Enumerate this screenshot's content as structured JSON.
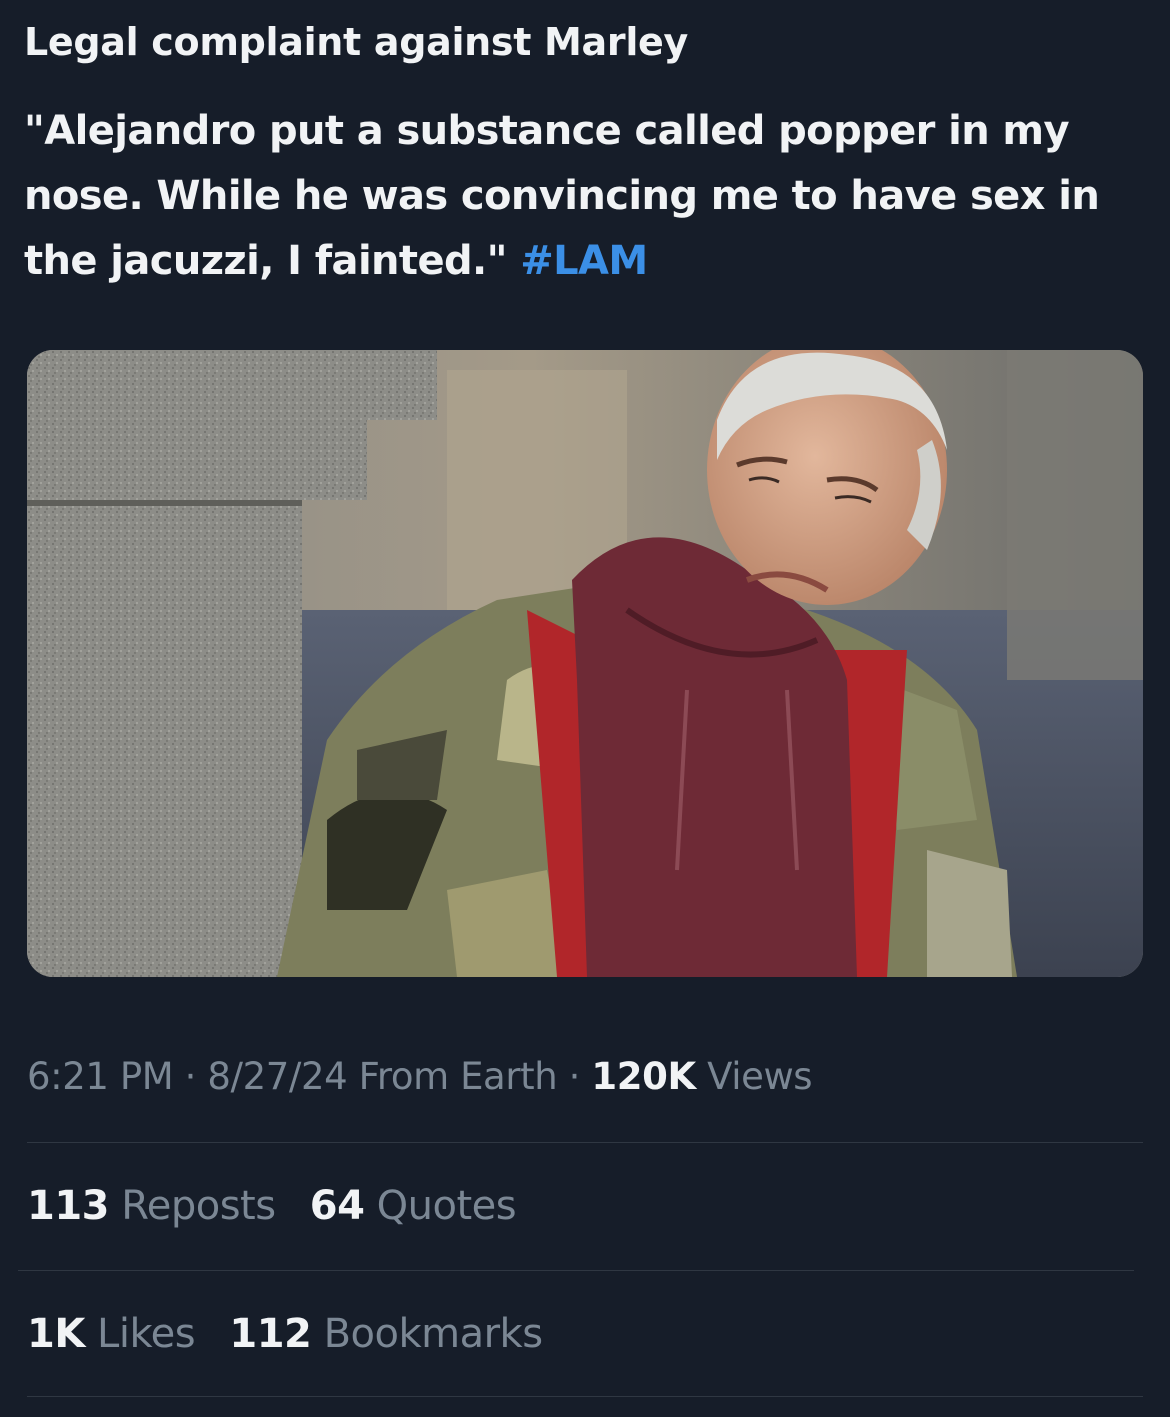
{
  "post": {
    "title": "Legal complaint against Marley",
    "text_line1": "\"Alejandro put a substance called popper in my",
    "text_line2": "nose. While he was convincing me to have sex in",
    "text_line3": "the jacuzzi, I fainted.\"",
    "hashtag": "#LAM"
  },
  "meta": {
    "time": "6:21 PM",
    "separator1": "·",
    "date": "8/27/24",
    "source": "From Earth",
    "separator2": "·",
    "views_count": "120K",
    "views_label": "Views"
  },
  "stats": {
    "reposts_count": "113",
    "reposts_label": "Reposts",
    "quotes_count": "64",
    "quotes_label": "Quotes",
    "likes_count": "1K",
    "likes_label": "Likes",
    "bookmarks_count": "112",
    "bookmarks_label": "Bookmarks"
  },
  "colors": {
    "background": "#161d29",
    "text": "#f1f3f5",
    "secondary": "#7b8794",
    "link": "#3b8fe6",
    "divider": "#2f3742"
  }
}
